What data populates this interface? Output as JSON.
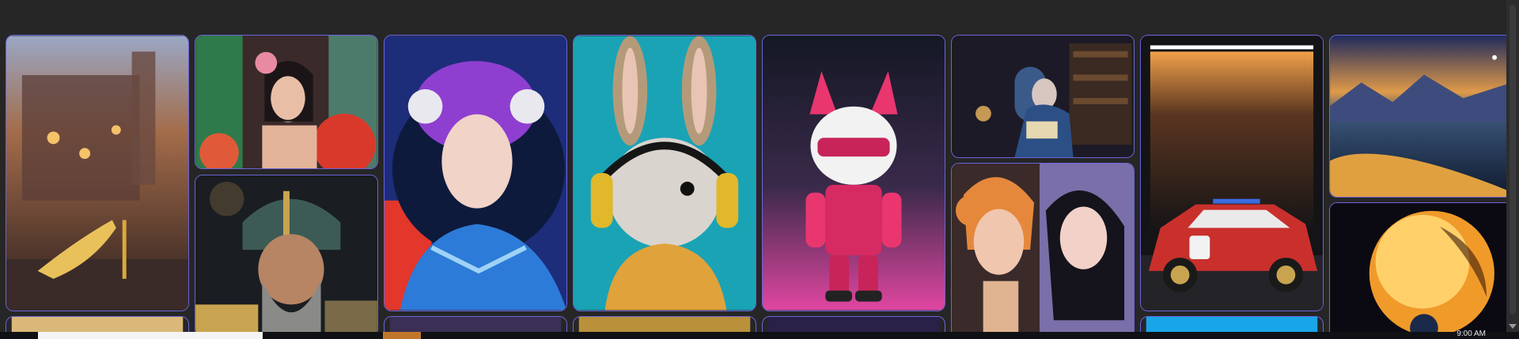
{
  "gallery": {
    "images": [
      {
        "name": "gold-stiletto-castle-image",
        "colors": [
          "#2b1e22",
          "#c78a45",
          "#e9c15a"
        ]
      },
      {
        "name": "floral-woman-art-deco-image",
        "colors": [
          "#6e2b2b",
          "#2f7a4a",
          "#e88aa2"
        ]
      },
      {
        "name": "armored-warrior-image",
        "colors": [
          "#1a1d22",
          "#3d5b55",
          "#c9a450"
        ]
      },
      {
        "name": "purple-hair-astronaut-girl-image",
        "colors": [
          "#1d2d7a",
          "#8e3fd0",
          "#2d7bd8"
        ]
      },
      {
        "name": "rabbit-headphones-image",
        "colors": [
          "#1aa3b5",
          "#e0a23a",
          "#d9d4ce"
        ]
      },
      {
        "name": "pink-robot-toy-image",
        "colors": [
          "#24172c",
          "#e046a0",
          "#f2f2f2"
        ]
      },
      {
        "name": "elf-reading-library-image",
        "colors": [
          "#1c1a26",
          "#3a5a8a",
          "#8ab0d8"
        ]
      },
      {
        "name": "two-women-portrait-image",
        "colors": [
          "#2a1d2e",
          "#e5883c",
          "#7a6fa8"
        ]
      },
      {
        "name": "police-race-car-garage-image",
        "colors": [
          "#141416",
          "#e8903a",
          "#c9302c"
        ]
      },
      {
        "name": "mountain-sunset-landscape-image",
        "colors": [
          "#1f2a5c",
          "#e09a4a",
          "#3a5478"
        ]
      },
      {
        "name": "glowing-planet-girl-image",
        "colors": [
          "#0b0a12",
          "#f09a2a",
          "#ffd06a"
        ]
      }
    ]
  },
  "taskbar": {
    "clock": "9:00 AM"
  }
}
